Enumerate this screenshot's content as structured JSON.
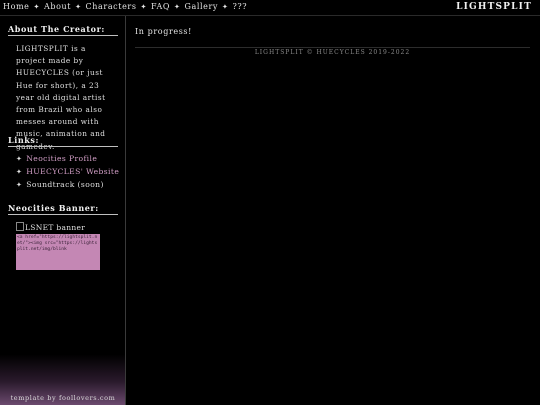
{
  "nav": {
    "items": [
      {
        "label": "Home"
      },
      {
        "label": "About"
      },
      {
        "label": "Characters"
      },
      {
        "label": "FAQ"
      },
      {
        "label": "Gallery"
      },
      {
        "label": "???"
      }
    ],
    "separator": "✦"
  },
  "brand": "LIGHTSPLIT",
  "sidebar": {
    "about_heading": "About The Creator:",
    "about_text": "LIGHTSPLIT is a project made by HUECYCLES (or just Hue for short), a 23 year old digital artist from Brazil who also messes around with music, animation and gamedev.",
    "links_heading": "Links:",
    "links": [
      {
        "label": "Neocities Profile",
        "linked": true
      },
      {
        "label": "HUECYCLES' Website",
        "linked": true
      },
      {
        "label": "Soundtrack (soon)",
        "linked": false
      }
    ],
    "link_bullet": "✦",
    "banner_heading": "Neocities Banner:",
    "banner_alt": "LSNET banner",
    "banner_code": "<a href=\"https://lightsplit.net/\"><img src=\"https://lightsplit.net/img/blink",
    "credit": "template by foollovers.com"
  },
  "main": {
    "content": "In progress!",
    "footer": "LIGHTSPLIT © HUECYCLES 2019-2022"
  },
  "colors": {
    "background": "#000000",
    "link": "#d4a0c8",
    "code_box": "#c487b4",
    "sidebar_gradient_end": "#6b4a6e"
  }
}
